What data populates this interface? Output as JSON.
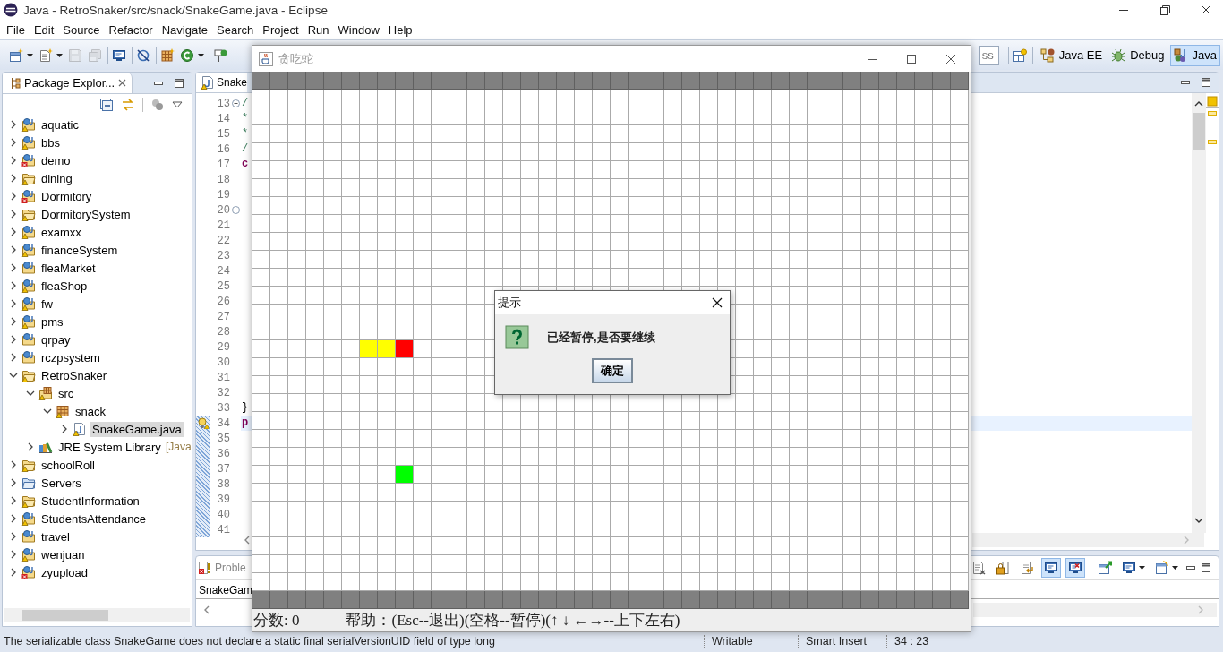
{
  "window": {
    "title": "Java - RetroSnaker/src/snack/SnakeGame.java - Eclipse"
  },
  "menu": [
    "File",
    "Edit",
    "Source",
    "Refactor",
    "Navigate",
    "Search",
    "Project",
    "Run",
    "Window",
    "Help"
  ],
  "toolbar": {
    "buttons": [
      {
        "kind": "new",
        "dropdown": true,
        "disabled": false
      },
      {
        "kind": "new-class",
        "dropdown": true,
        "disabled": false
      },
      {
        "kind": "save",
        "dropdown": false,
        "disabled": true
      },
      {
        "kind": "save-all",
        "dropdown": false,
        "disabled": true
      },
      {
        "kind": "separator"
      },
      {
        "kind": "console",
        "dropdown": false,
        "disabled": false
      },
      {
        "kind": "separator"
      },
      {
        "kind": "skip",
        "dropdown": false,
        "disabled": false
      },
      {
        "kind": "separator"
      },
      {
        "kind": "package",
        "dropdown": false,
        "disabled": false
      },
      {
        "kind": "run",
        "dropdown": true,
        "disabled": false
      },
      {
        "kind": "separator"
      },
      {
        "kind": "tool",
        "dropdown": false,
        "disabled": false
      }
    ],
    "quick_access": {
      "placeholder": "ss"
    },
    "perspectives": [
      {
        "kind": "java-ee",
        "label": "Java EE",
        "selected": false
      },
      {
        "kind": "debug",
        "label": "Debug",
        "selected": false
      },
      {
        "kind": "java",
        "label": "Java",
        "selected": true
      }
    ]
  },
  "explorer": {
    "title": "Package Explor...",
    "tree": [
      {
        "label": "aquatic",
        "kind": "java-project",
        "warning": true,
        "error": false,
        "expanded": false,
        "selected": false
      },
      {
        "label": "bbs",
        "kind": "java-project",
        "warning": true,
        "error": false,
        "expanded": false,
        "selected": false
      },
      {
        "label": "demo",
        "kind": "java-project",
        "warning": false,
        "error": true,
        "expanded": false,
        "selected": false
      },
      {
        "label": "dining",
        "kind": "project",
        "warning": true,
        "error": false,
        "expanded": false,
        "selected": false
      },
      {
        "label": "Dormitory",
        "kind": "java-project",
        "warning": false,
        "error": true,
        "expanded": false,
        "selected": false
      },
      {
        "label": "DormitorySystem",
        "kind": "project",
        "warning": true,
        "error": false,
        "expanded": false,
        "selected": false
      },
      {
        "label": "examxx",
        "kind": "java-project",
        "warning": true,
        "error": false,
        "expanded": false,
        "selected": false
      },
      {
        "label": "financeSystem",
        "kind": "java-project",
        "warning": true,
        "error": false,
        "expanded": false,
        "selected": false
      },
      {
        "label": "fleaMarket",
        "kind": "java-project",
        "warning": false,
        "error": false,
        "expanded": false,
        "selected": false
      },
      {
        "label": "fleaShop",
        "kind": "java-project",
        "warning": true,
        "error": false,
        "expanded": false,
        "selected": false
      },
      {
        "label": "fw",
        "kind": "java-project",
        "warning": true,
        "error": false,
        "expanded": false,
        "selected": false
      },
      {
        "label": "pms",
        "kind": "java-project",
        "warning": true,
        "error": false,
        "expanded": false,
        "selected": false
      },
      {
        "label": "qrpay",
        "kind": "java-project",
        "warning": false,
        "error": false,
        "expanded": false,
        "selected": false
      },
      {
        "label": "rczpsystem",
        "kind": "java-project",
        "warning": false,
        "error": false,
        "expanded": false,
        "selected": false
      },
      {
        "label": "RetroSnaker",
        "kind": "project",
        "warning": true,
        "error": false,
        "expanded": true,
        "selected": false,
        "children": [
          {
            "label": "src",
            "kind": "source-folder",
            "warning": true,
            "error": false,
            "expanded": true,
            "selected": false,
            "children": [
              {
                "label": "snack",
                "kind": "package",
                "warning": true,
                "error": false,
                "expanded": true,
                "selected": false,
                "children": [
                  {
                    "label": "SnakeGame.java",
                    "kind": "java-file",
                    "warning": true,
                    "error": false,
                    "expanded": false,
                    "selected": true
                  }
                ]
              }
            ]
          },
          {
            "label": "JRE System Library",
            "suffix": "[Java",
            "kind": "library",
            "warning": false,
            "error": false,
            "expanded": false,
            "selected": false
          }
        ]
      },
      {
        "label": "schoolRoll",
        "kind": "project",
        "warning": true,
        "error": false,
        "expanded": false,
        "selected": false
      },
      {
        "label": "Servers",
        "kind": "folder",
        "warning": false,
        "error": false,
        "expanded": false,
        "selected": false
      },
      {
        "label": "StudentInformation",
        "kind": "project",
        "warning": true,
        "error": false,
        "expanded": false,
        "selected": false
      },
      {
        "label": "StudentsAttendance",
        "kind": "java-project",
        "warning": true,
        "error": false,
        "expanded": false,
        "selected": false
      },
      {
        "label": "travel",
        "kind": "java-project",
        "warning": false,
        "error": false,
        "expanded": false,
        "selected": false
      },
      {
        "label": "wenjuan",
        "kind": "java-project",
        "warning": true,
        "error": false,
        "expanded": false,
        "selected": false
      },
      {
        "label": "zyupload",
        "kind": "java-project",
        "warning": false,
        "error": true,
        "expanded": false,
        "selected": false
      }
    ]
  },
  "editor": {
    "tab": "Snake",
    "lines": [
      {
        "number": "13",
        "code": "/",
        "kind": "comment",
        "fold": true,
        "in_range": false,
        "warning": false,
        "current": false
      },
      {
        "number": "14",
        "code": "*",
        "kind": "comment",
        "fold": false,
        "in_range": false,
        "warning": false,
        "current": false
      },
      {
        "number": "15",
        "code": "*",
        "kind": "comment",
        "fold": false,
        "in_range": false,
        "warning": false,
        "current": false
      },
      {
        "number": "16",
        "code": "/",
        "kind": "comment",
        "fold": false,
        "in_range": false,
        "warning": false,
        "current": false
      },
      {
        "number": "17",
        "code": "c",
        "kind": "keyword",
        "fold": false,
        "in_range": false,
        "warning": false,
        "current": false
      },
      {
        "number": "18",
        "fold": false,
        "in_range": false,
        "warning": false,
        "current": false
      },
      {
        "number": "19",
        "fold": false,
        "in_range": false,
        "warning": false,
        "current": false
      },
      {
        "number": "20",
        "fold": true,
        "in_range": false,
        "warning": false,
        "current": false
      },
      {
        "number": "21",
        "fold": false,
        "in_range": false,
        "warning": false,
        "current": false
      },
      {
        "number": "22",
        "fold": false,
        "in_range": false,
        "warning": false,
        "current": false
      },
      {
        "number": "23",
        "fold": false,
        "in_range": false,
        "warning": false,
        "current": false
      },
      {
        "number": "24",
        "fold": false,
        "in_range": false,
        "warning": false,
        "current": false
      },
      {
        "number": "25",
        "fold": false,
        "in_range": false,
        "warning": false,
        "current": false
      },
      {
        "number": "26",
        "fold": false,
        "in_range": false,
        "warning": false,
        "current": false
      },
      {
        "number": "27",
        "fold": false,
        "in_range": false,
        "warning": false,
        "current": false
      },
      {
        "number": "28",
        "fold": false,
        "in_range": false,
        "warning": false,
        "current": false
      },
      {
        "number": "29",
        "fold": false,
        "in_range": false,
        "warning": false,
        "current": false
      },
      {
        "number": "30",
        "fold": false,
        "in_range": false,
        "warning": false,
        "current": false
      },
      {
        "number": "31",
        "fold": false,
        "in_range": false,
        "warning": false,
        "current": false
      },
      {
        "number": "32",
        "fold": false,
        "in_range": false,
        "warning": false,
        "current": false
      },
      {
        "number": "33",
        "code": "}",
        "kind": "plain",
        "fold": false,
        "in_range": false,
        "warning": false,
        "current": false
      },
      {
        "number": "34",
        "code": "p",
        "kind": "keyword",
        "fold": false,
        "in_range": true,
        "warning": true,
        "current": true
      },
      {
        "number": "35",
        "fold": false,
        "in_range": true,
        "warning": false,
        "current": false
      },
      {
        "number": "36",
        "fold": false,
        "in_range": true,
        "warning": false,
        "current": false
      },
      {
        "number": "37",
        "fold": false,
        "in_range": true,
        "warning": false,
        "current": false
      },
      {
        "number": "38",
        "fold": false,
        "in_range": true,
        "warning": false,
        "current": false
      },
      {
        "number": "39",
        "fold": false,
        "in_range": true,
        "warning": false,
        "current": false
      },
      {
        "number": "40",
        "fold": false,
        "in_range": true,
        "warning": false,
        "current": false
      },
      {
        "number": "41",
        "fold": false,
        "in_range": true,
        "warning": false,
        "current": false
      }
    ]
  },
  "bottom_panel": {
    "tab": "Proble",
    "row": "SnakeGam",
    "buttons": [
      {
        "kind": "clear",
        "dropdown": false,
        "selected": false
      },
      {
        "kind": "lock",
        "dropdown": false,
        "selected": false
      },
      {
        "kind": "doc-arrow",
        "dropdown": false,
        "selected": false
      },
      {
        "kind": "console",
        "dropdown": false,
        "selected": true
      },
      {
        "kind": "console-error",
        "dropdown": false,
        "selected": true
      },
      {
        "kind": "separator"
      },
      {
        "kind": "pin",
        "dropdown": false,
        "selected": false
      },
      {
        "kind": "console",
        "dropdown": true,
        "selected": false
      },
      {
        "kind": "new-window",
        "dropdown": true,
        "selected": false
      }
    ]
  },
  "status_bar": {
    "message": "The serializable class SnakeGame does not declare a static final serialVersionUID field of type long",
    "mode": "Writable",
    "insert": "Smart Insert",
    "position": "34 : 23"
  },
  "game": {
    "title": "贪吃蛇",
    "board": [
      {
        "kind": "wall"
      },
      {
        "kind": "empty"
      },
      {
        "kind": "empty"
      },
      {
        "kind": "empty"
      },
      {
        "kind": "empty"
      },
      {
        "kind": "empty"
      },
      {
        "kind": "empty"
      },
      {
        "kind": "empty"
      },
      {
        "kind": "empty"
      },
      {
        "kind": "empty"
      },
      {
        "kind": "empty"
      },
      {
        "kind": "empty"
      },
      {
        "kind": "empty"
      },
      {
        "kind": "empty"
      },
      {
        "kind": "empty"
      },
      {
        "kind": "mixed",
        "cells": [
          {
            "kind": "empty"
          },
          {
            "kind": "empty"
          },
          {
            "kind": "empty"
          },
          {
            "kind": "empty"
          },
          {
            "kind": "empty"
          },
          {
            "kind": "empty"
          },
          {
            "kind": "body"
          },
          {
            "kind": "body"
          },
          {
            "kind": "head"
          },
          {
            "kind": "empty"
          },
          {
            "kind": "empty"
          },
          {
            "kind": "empty"
          },
          {
            "kind": "empty"
          },
          {
            "kind": "empty"
          },
          {
            "kind": "empty"
          },
          {
            "kind": "empty"
          },
          {
            "kind": "empty"
          },
          {
            "kind": "empty"
          },
          {
            "kind": "empty"
          },
          {
            "kind": "empty"
          },
          {
            "kind": "empty"
          },
          {
            "kind": "empty"
          },
          {
            "kind": "empty"
          },
          {
            "kind": "empty"
          },
          {
            "kind": "empty"
          },
          {
            "kind": "empty"
          },
          {
            "kind": "empty"
          },
          {
            "kind": "empty"
          },
          {
            "kind": "empty"
          },
          {
            "kind": "empty"
          },
          {
            "kind": "empty"
          },
          {
            "kind": "empty"
          },
          {
            "kind": "empty"
          },
          {
            "kind": "empty"
          },
          {
            "kind": "empty"
          },
          {
            "kind": "empty"
          },
          {
            "kind": "empty"
          },
          {
            "kind": "empty"
          },
          {
            "kind": "empty"
          },
          {
            "kind": "empty"
          }
        ]
      },
      {
        "kind": "empty"
      },
      {
        "kind": "empty"
      },
      {
        "kind": "empty"
      },
      {
        "kind": "empty"
      },
      {
        "kind": "empty"
      },
      {
        "kind": "empty"
      },
      {
        "kind": "mixed",
        "cells": [
          {
            "kind": "empty"
          },
          {
            "kind": "empty"
          },
          {
            "kind": "empty"
          },
          {
            "kind": "empty"
          },
          {
            "kind": "empty"
          },
          {
            "kind": "empty"
          },
          {
            "kind": "empty"
          },
          {
            "kind": "empty"
          },
          {
            "kind": "food"
          },
          {
            "kind": "empty"
          },
          {
            "kind": "empty"
          },
          {
            "kind": "empty"
          },
          {
            "kind": "empty"
          },
          {
            "kind": "empty"
          },
          {
            "kind": "empty"
          },
          {
            "kind": "empty"
          },
          {
            "kind": "empty"
          },
          {
            "kind": "empty"
          },
          {
            "kind": "empty"
          },
          {
            "kind": "empty"
          },
          {
            "kind": "empty"
          },
          {
            "kind": "empty"
          },
          {
            "kind": "empty"
          },
          {
            "kind": "empty"
          },
          {
            "kind": "empty"
          },
          {
            "kind": "empty"
          },
          {
            "kind": "empty"
          },
          {
            "kind": "empty"
          },
          {
            "kind": "empty"
          },
          {
            "kind": "empty"
          },
          {
            "kind": "empty"
          },
          {
            "kind": "empty"
          },
          {
            "kind": "empty"
          },
          {
            "kind": "empty"
          },
          {
            "kind": "empty"
          },
          {
            "kind": "empty"
          },
          {
            "kind": "empty"
          },
          {
            "kind": "empty"
          },
          {
            "kind": "empty"
          },
          {
            "kind": "empty"
          }
        ]
      },
      {
        "kind": "empty"
      },
      {
        "kind": "empty"
      },
      {
        "kind": "empty"
      },
      {
        "kind": "empty"
      },
      {
        "kind": "empty"
      },
      {
        "kind": "empty"
      },
      {
        "kind": "wall"
      }
    ],
    "score": "分数: 0",
    "help": "帮助：(Esc--退出)(空格--暂停)(↑ ↓ ←→--上下左右)"
  },
  "dialog": {
    "title": "提示",
    "message": "已经暂停,是否要继续",
    "button": "确定"
  }
}
